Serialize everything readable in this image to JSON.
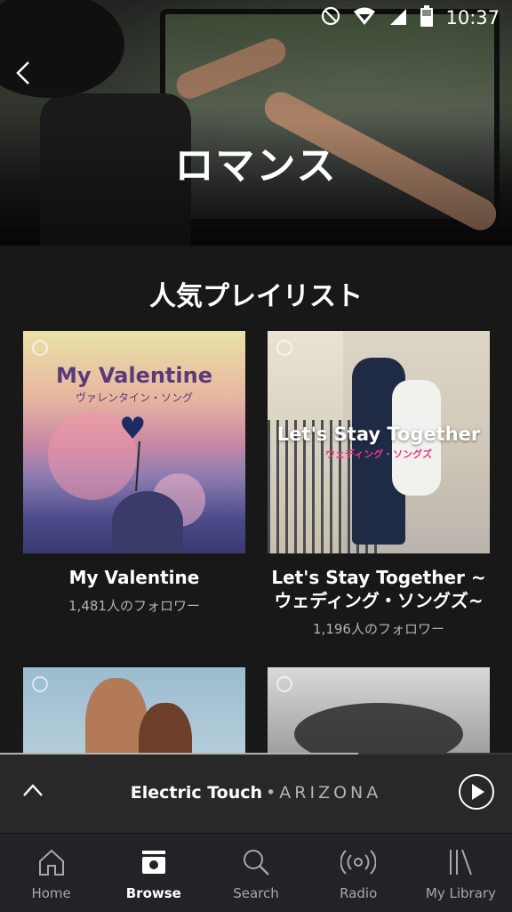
{
  "status_bar": {
    "time": "10:37",
    "icons": [
      "do-not-disturb-icon",
      "wifi-icon",
      "signal-icon",
      "battery-icon"
    ]
  },
  "header": {
    "back_icon": "chevron-left-icon",
    "title": "ロマンス"
  },
  "section": {
    "title": "人気プレイリスト"
  },
  "playlists": [
    {
      "title": "My Valentine",
      "followers": "1,481人のフォロワー",
      "cover_title": "My Valentine",
      "cover_subtitle": "ヴァレンタイン・ソング"
    },
    {
      "title": "Let's Stay Together ~ウェディング・ソングズ~",
      "followers": "1,196人のフォロワー",
      "cover_title": "Let's Stay Together",
      "cover_subtitle": "ウェディング・ソングズ"
    },
    {
      "title": "",
      "followers": ""
    },
    {
      "title": "",
      "followers": ""
    }
  ],
  "mini_player": {
    "song": "Electric Touch",
    "separator": "•",
    "artist": "ARIZONA",
    "progress": 0.7,
    "expand_icon": "chevron-up-icon",
    "play_icon": "play-icon"
  },
  "tabs": [
    {
      "label": "Home",
      "icon": "home-icon",
      "active": false
    },
    {
      "label": "Browse",
      "icon": "browse-icon",
      "active": true
    },
    {
      "label": "Search",
      "icon": "search-icon",
      "active": false
    },
    {
      "label": "Radio",
      "icon": "radio-icon",
      "active": false
    },
    {
      "label": "My Library",
      "icon": "library-icon",
      "active": false
    }
  ],
  "colors": {
    "background": "#181818",
    "player_bg": "#282828",
    "tabbar_bg": "#222326",
    "text_muted": "#b3b3b3",
    "accent_pink": "#e6388c"
  }
}
